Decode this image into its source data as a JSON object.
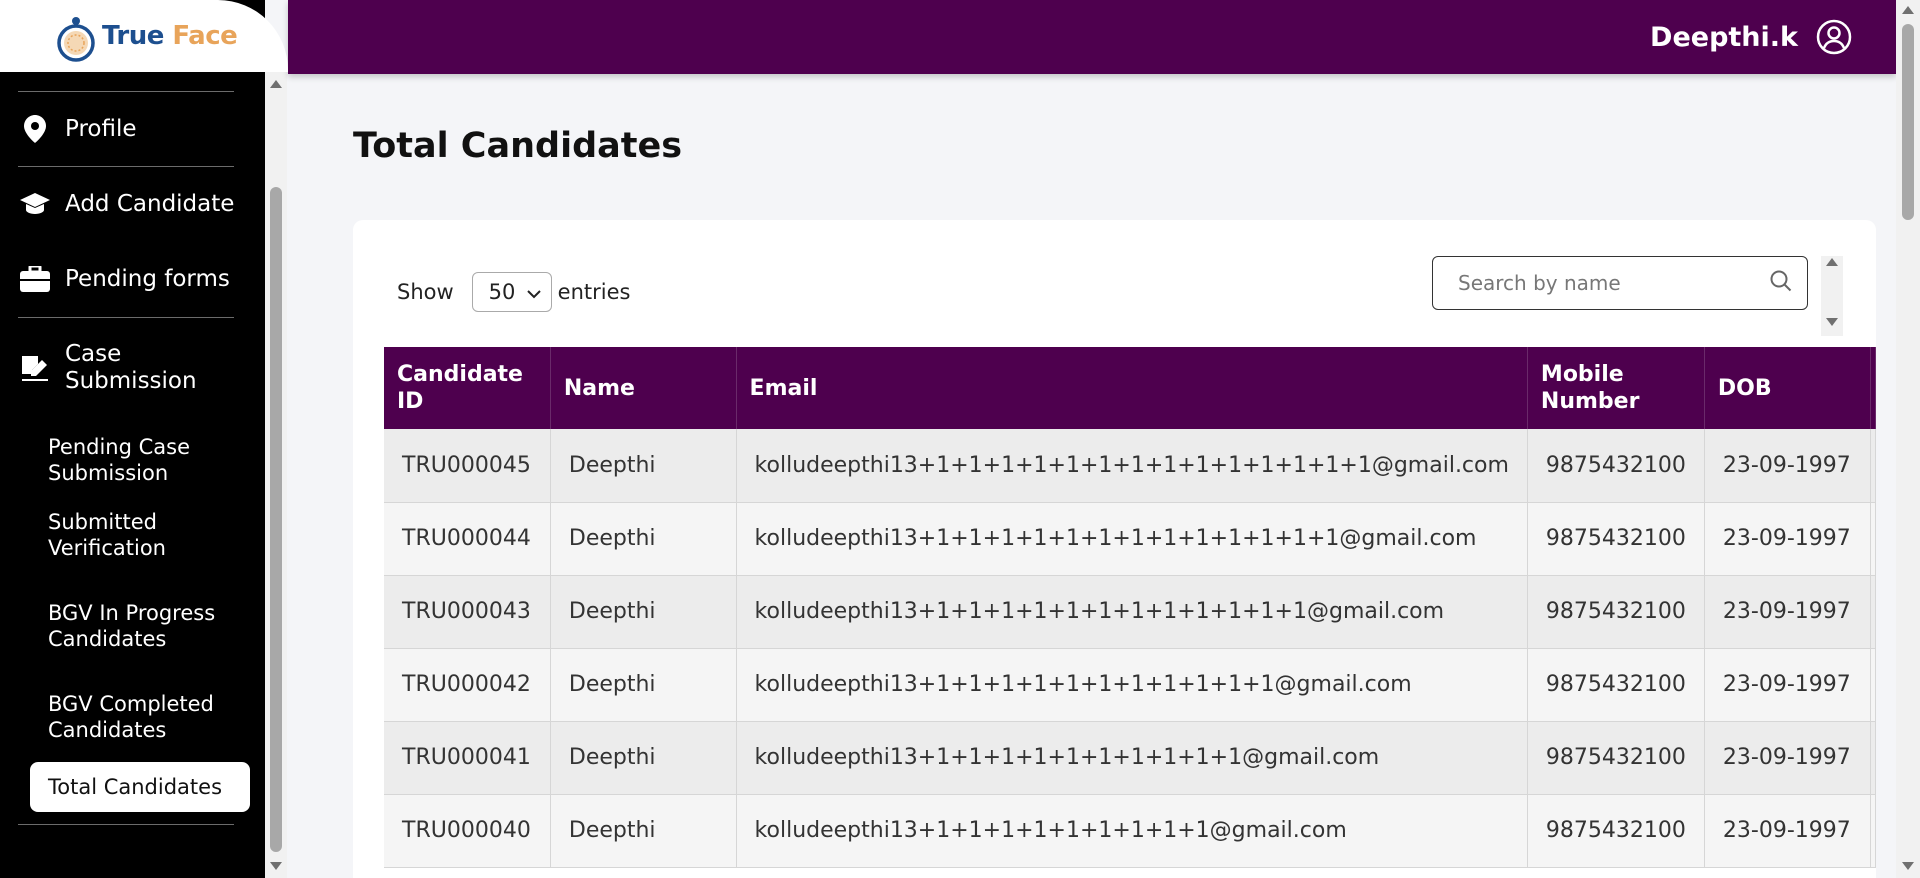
{
  "brand": {
    "part1": "True",
    "part2": " Face"
  },
  "header": {
    "user_name": "Deepthi.k"
  },
  "sidebar": {
    "items": [
      {
        "label": "Profile",
        "icon": "location-pin-icon"
      },
      {
        "label": "Add Candidate",
        "icon": "graduation-cap-icon"
      },
      {
        "label": "Pending forms",
        "icon": "briefcase-icon"
      },
      {
        "label": "Case Submission",
        "icon": "signature-icon"
      }
    ],
    "sub_items": [
      {
        "label": "Pending Case Submission"
      },
      {
        "label": "Submitted Verification"
      },
      {
        "label": "BGV In Progress Candidates"
      },
      {
        "label": "BGV Completed Candidates"
      },
      {
        "label": "Total Candidates"
      }
    ]
  },
  "page": {
    "title": "Total Candidates"
  },
  "controls": {
    "show_label": "Show",
    "entries_value": "50",
    "entries_label": "entries",
    "search_placeholder": "Search by name"
  },
  "table": {
    "columns": [
      "Candidate ID",
      "Name",
      "Email",
      "Mobile Number",
      "DOB"
    ],
    "rows": [
      [
        "TRU000045",
        "Deepthi",
        "kolludeepthi13+1+1+1+1+1+1+1+1+1+1+1+1+1+1@gmail.com",
        "9875432100",
        "23-09-1997"
      ],
      [
        "TRU000044",
        "Deepthi",
        "kolludeepthi13+1+1+1+1+1+1+1+1+1+1+1+1+1@gmail.com",
        "9875432100",
        "23-09-1997"
      ],
      [
        "TRU000043",
        "Deepthi",
        "kolludeepthi13+1+1+1+1+1+1+1+1+1+1+1+1@gmail.com",
        "9875432100",
        "23-09-1997"
      ],
      [
        "TRU000042",
        "Deepthi",
        "kolludeepthi13+1+1+1+1+1+1+1+1+1+1+1@gmail.com",
        "9875432100",
        "23-09-1997"
      ],
      [
        "TRU000041",
        "Deepthi",
        "kolludeepthi13+1+1+1+1+1+1+1+1+1+1@gmail.com",
        "9875432100",
        "23-09-1997"
      ],
      [
        "TRU000040",
        "Deepthi",
        "kolludeepthi13+1+1+1+1+1+1+1+1+1@gmail.com",
        "9875432100",
        "23-09-1997"
      ]
    ]
  },
  "colors": {
    "brand_purple": "#4e004e",
    "logo_blue": "#1d4f8f",
    "logo_orange": "#e8a45a"
  }
}
